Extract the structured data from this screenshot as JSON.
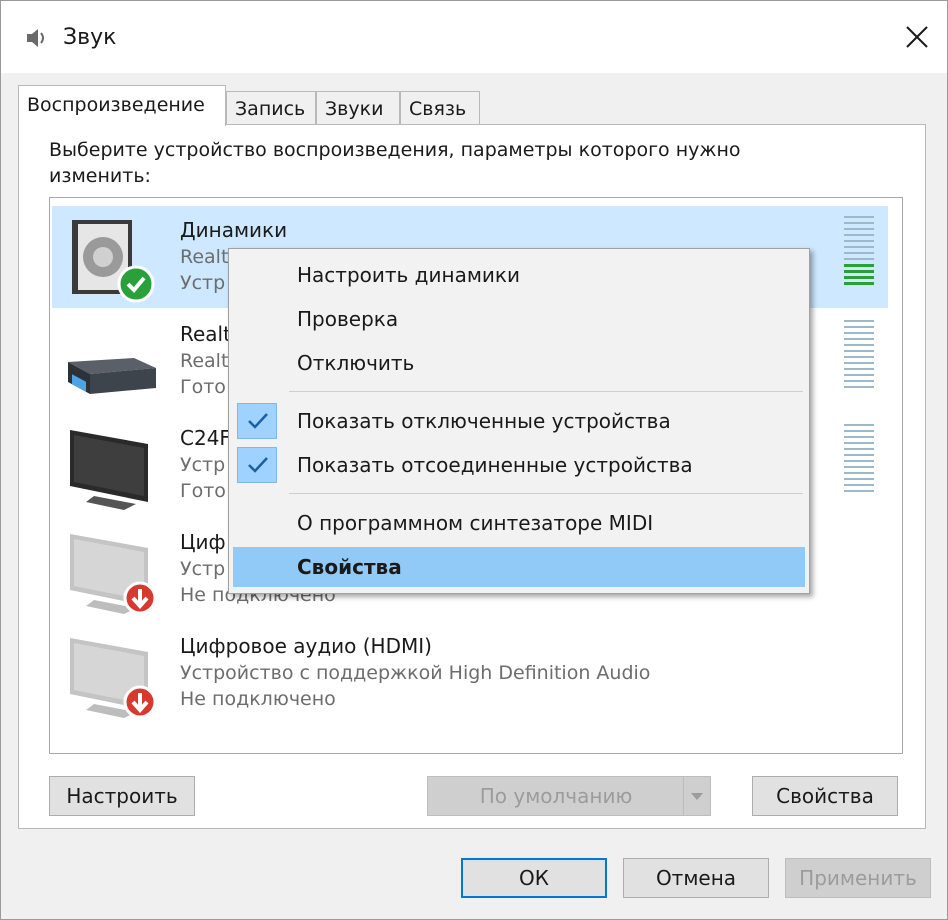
{
  "window": {
    "title": "Звук",
    "tabs": [
      {
        "label": "Воспроизведение"
      },
      {
        "label": "Запись"
      },
      {
        "label": "Звуки"
      },
      {
        "label": "Связь"
      }
    ],
    "instruction": "Выберите устройство воспроизведения, параметры которого нужно изменить:"
  },
  "devices": [
    {
      "name": "Динамики",
      "desc": "Realt",
      "status": "Устр",
      "icon": "speaker-icon",
      "badge": "default-check",
      "selected": true,
      "meter_level": 0.3
    },
    {
      "name": "Realt",
      "desc": "Realt",
      "status": "Гото",
      "icon": "receiver-icon",
      "badge": "",
      "selected": false,
      "meter_level": 0
    },
    {
      "name": "C24F",
      "desc": "Устр",
      "status": "Гото",
      "icon": "monitor-icon",
      "badge": "",
      "selected": false,
      "meter_level": 0
    },
    {
      "name": "Циф",
      "desc": "Устр",
      "status": "Не подключено",
      "icon": "monitor-disabled-icon",
      "badge": "disconnected-arrow",
      "selected": false
    },
    {
      "name": "Цифровое аудио (HDMI)",
      "desc": "Устройство с поддержкой High Definition Audio",
      "status": "Не подключено",
      "icon": "monitor-disabled-icon",
      "badge": "disconnected-arrow",
      "selected": false
    }
  ],
  "context_menu": {
    "items": [
      {
        "label": "Настроить динамики",
        "checked": false
      },
      {
        "label": "Проверка",
        "checked": false
      },
      {
        "label": "Отключить",
        "checked": false
      },
      {
        "label": "Показать отключенные устройства",
        "checked": true
      },
      {
        "label": "Показать отсоединенные устройства",
        "checked": true
      },
      {
        "label": "О программном синтезаторе MIDI",
        "checked": false
      },
      {
        "label": "Свойства",
        "checked": false,
        "highlighted": true
      }
    ]
  },
  "buttons": {
    "configure": "Настроить",
    "set_default": "По умолчанию",
    "properties": "Свойства",
    "ok": "ОК",
    "cancel": "Отмена",
    "apply": "Применить"
  },
  "colors": {
    "selection": "#cde8ff",
    "menu_highlight": "#91c9f7",
    "accent": "#0078d7",
    "meter_active": "#2aa03a"
  }
}
